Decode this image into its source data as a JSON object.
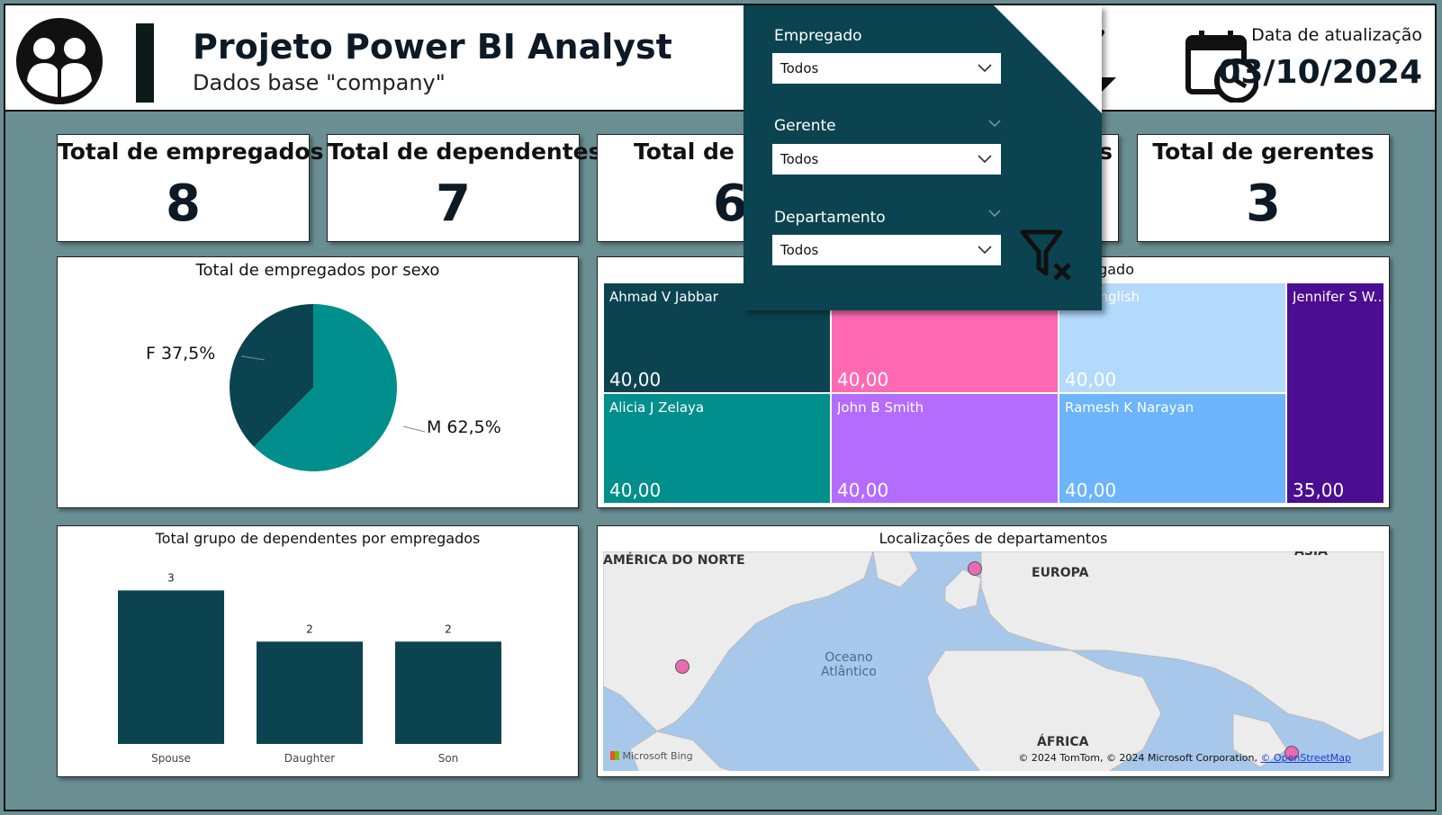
{
  "header": {
    "title": "Projeto Power BI Analyst",
    "subtitle": "Dados base \"company\"",
    "update_label": "Data de atualização",
    "update_date": "03/10/2024"
  },
  "kpis": [
    {
      "label": "Total de empregados",
      "value": "8"
    },
    {
      "label": "Total de dependentes",
      "value": "7"
    },
    {
      "label": "Total de pr",
      "value": "6"
    },
    {
      "label": "s",
      "value": ""
    },
    {
      "label": "Total de gerentes",
      "value": "3"
    }
  ],
  "pie": {
    "title": "Total de empregados por sexo",
    "label_f": "F 37,5%",
    "label_m": "M 62,5%"
  },
  "treemap": {
    "title_visible": "regado",
    "cells": [
      {
        "name": "Ahmad V Jabbar",
        "value": "40,00",
        "color": "#0b4450"
      },
      {
        "name": "",
        "value": "40,00",
        "color": "#ff69b4"
      },
      {
        "name": "A English",
        "value": "40,00",
        "color": "#b3d9fb"
      },
      {
        "name": "Jennifer S W...",
        "value": "35,00",
        "color": "#4b0d91"
      },
      {
        "name": "Alicia J Zelaya",
        "value": "40,00",
        "color": "#008f8c"
      },
      {
        "name": "John B Smith",
        "value": "40,00",
        "color": "#b46cff"
      },
      {
        "name": "Ramesh K Narayan",
        "value": "40,00",
        "color": "#6cb4fc"
      }
    ]
  },
  "bar_chart": {
    "title": "Total grupo de dependentes por empregados"
  },
  "chart_data": {
    "type": "bar",
    "title": "Total grupo de dependentes por empregados",
    "categories": [
      "Spouse",
      "Daughter",
      "Son"
    ],
    "values": [
      3,
      2,
      2
    ],
    "ylim": [
      0,
      3.2
    ],
    "color": "#0b4450"
  },
  "pie_data": {
    "type": "pie",
    "slices": [
      {
        "label": "F",
        "percent": 37.5,
        "color": "#0b4450"
      },
      {
        "label": "M",
        "percent": 62.5,
        "color": "#008f8c"
      }
    ]
  },
  "map": {
    "title": "Localizações de departamentos",
    "labels": {
      "na": "AMÉRICA DO NORTE",
      "eu": "EUROPA",
      "asia": "ÁSIA",
      "africa": "ÁFRICA",
      "ocean_1": "Oceano",
      "ocean_2": "Atlântico"
    },
    "bing": "Microsoft Bing",
    "copyright": "© 2024 TomTom, © 2024 Microsoft Corporation, ",
    "osm": "© OpenStreetMap"
  },
  "slicers": [
    {
      "label": "Empregado",
      "value": "Todos"
    },
    {
      "label": "Gerente",
      "value": "Todos"
    },
    {
      "label": "Departamento",
      "value": "Todos"
    }
  ],
  "colors": {
    "background": "#6a8f93",
    "accent_dark": "#0b4450",
    "teal": "#008f8c"
  }
}
